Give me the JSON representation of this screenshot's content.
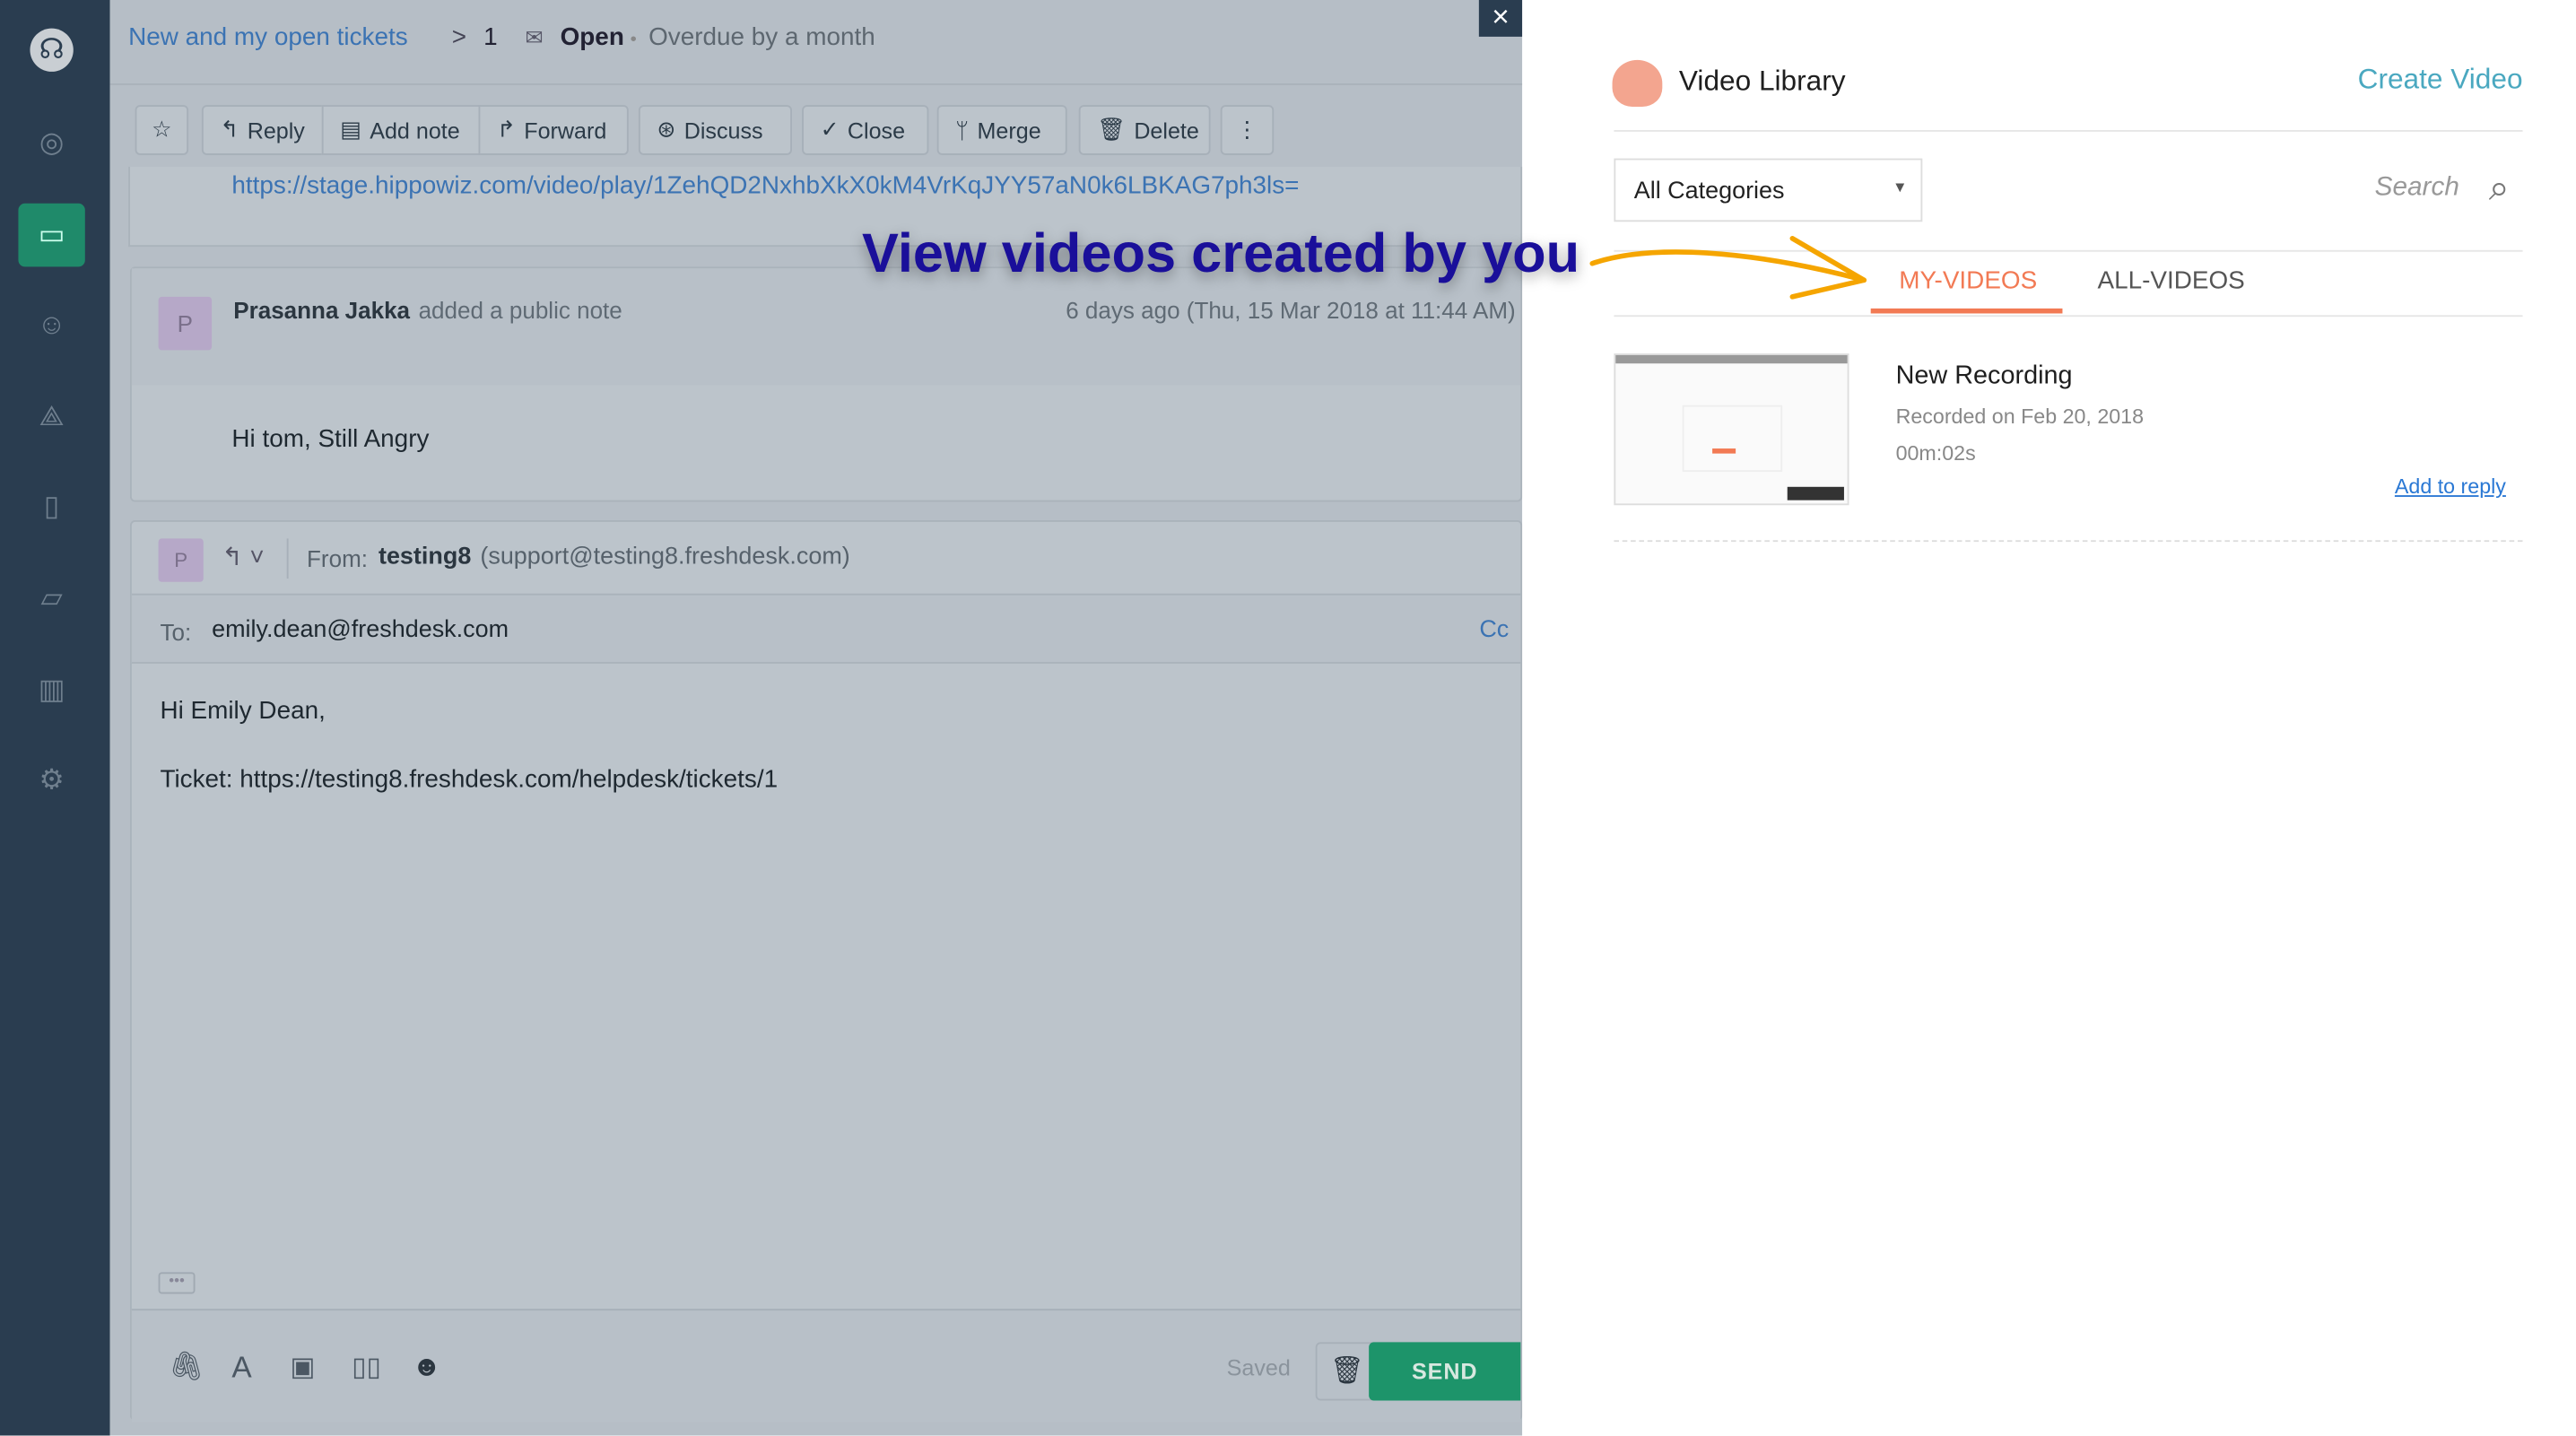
{
  "sidebar": {
    "items": [
      "headset-logo",
      "dashboard",
      "tickets",
      "contacts",
      "social",
      "solutions",
      "forums",
      "reports",
      "admin"
    ]
  },
  "header": {
    "breadcrumb_link": "New and my open tickets",
    "separator": ">",
    "ticket_number": "1",
    "status": "Open",
    "dot": "•",
    "overdue": "Overdue by a month"
  },
  "toolbar": {
    "reply": "Reply",
    "add_note": "Add note",
    "forward": "Forward",
    "discuss": "Discuss",
    "close": "Close",
    "merge": "Merge",
    "delete": "Delete"
  },
  "conversation": {
    "link": "https://stage.hippowiz.com/video/play/1ZehQD2NxhbXkX0kM4VrKqJYY57aN0k6LBKAG7ph3ls=",
    "note": {
      "avatar": "P",
      "author": "Prasanna Jakka",
      "action": "added a public note",
      "time": "6 days ago (Thu, 15 Mar 2018 at 11:44 AM)",
      "body": "Hi tom, Still Angry"
    }
  },
  "composer": {
    "avatar": "P",
    "from_label": "From:",
    "from_name": "testing8",
    "from_email": "(support@testing8.freshdesk.com)",
    "to_label": "To:",
    "to": "emily.dean@freshdesk.com",
    "cc": "Cc",
    "body_line1": "Hi Emily Dean,",
    "body_line2": "Ticket: https://testing8.freshdesk.com/helpdesk/tickets/1",
    "saved": "Saved",
    "send": "SEND"
  },
  "close_overlay": "×",
  "annotation": {
    "text": "View videos created by you",
    "color": "#1a0f9a",
    "arrow_color": "#f5a500"
  },
  "panel": {
    "title": "Video Library",
    "create": "Create Video",
    "category": "All Categories",
    "search_placeholder": "Search",
    "tabs": [
      {
        "label": "MY-VIDEOS",
        "active": true
      },
      {
        "label": "ALL-VIDEOS",
        "active": false
      }
    ],
    "videos": [
      {
        "title": "New Recording",
        "recorded": "Recorded on Feb 20, 2018",
        "duration": "00m:02s",
        "action": "Add to reply"
      }
    ],
    "accent": "#f27a54",
    "link_color": "#4aa8c0"
  }
}
